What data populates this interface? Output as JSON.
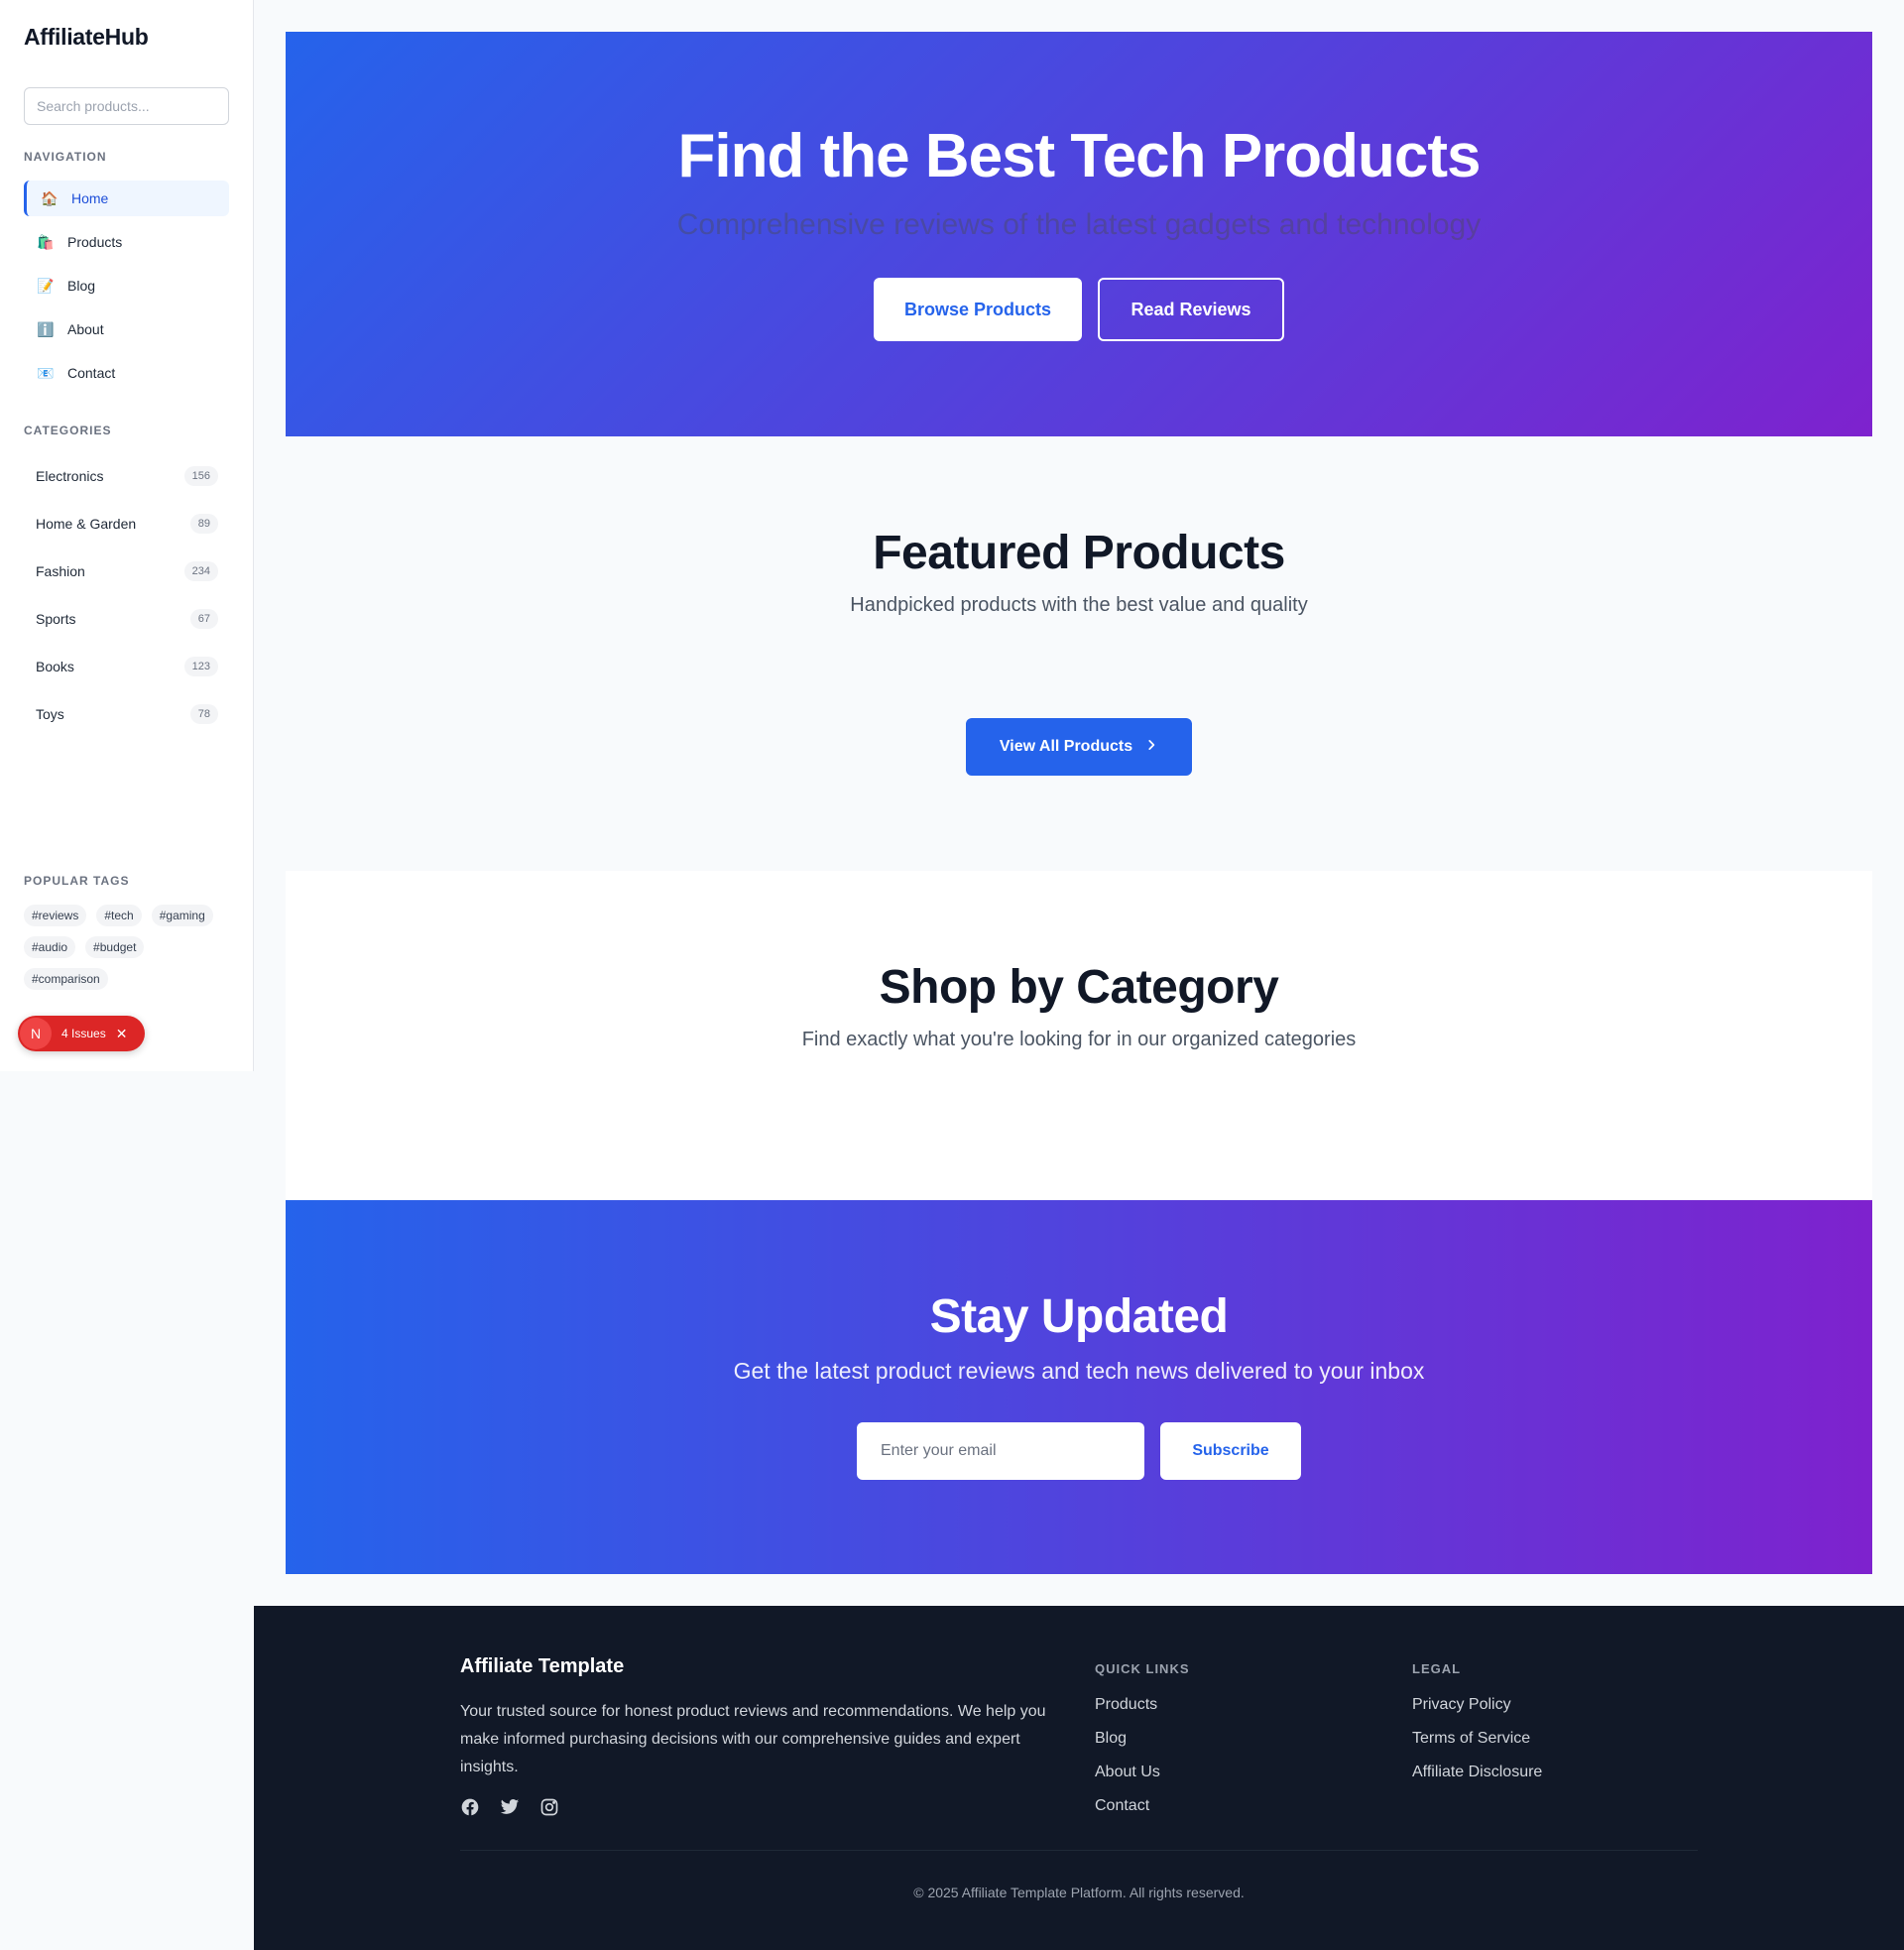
{
  "sidebar": {
    "logo": "AffiliateHub",
    "search_placeholder": "Search products...",
    "nav_title": "NAVIGATION",
    "nav_items": [
      {
        "label": "Home",
        "icon": "🏠"
      },
      {
        "label": "Products",
        "icon": "🛍️"
      },
      {
        "label": "Blog",
        "icon": "📝"
      },
      {
        "label": "About",
        "icon": "ℹ️"
      },
      {
        "label": "Contact",
        "icon": "📧"
      }
    ],
    "categories_title": "CATEGORIES",
    "categories": [
      {
        "label": "Electronics",
        "count": "156"
      },
      {
        "label": "Home & Garden",
        "count": "89"
      },
      {
        "label": "Fashion",
        "count": "234"
      },
      {
        "label": "Sports",
        "count": "67"
      },
      {
        "label": "Books",
        "count": "123"
      },
      {
        "label": "Toys",
        "count": "78"
      }
    ],
    "tags_title": "POPULAR TAGS",
    "tags": [
      "#reviews",
      "#tech",
      "#gaming",
      "#audio",
      "#budget",
      "#comparison"
    ],
    "issues": {
      "badge": "N",
      "label": "4 Issues",
      "close": "✕"
    }
  },
  "hero": {
    "title": "Find the Best Tech Products",
    "subtitle": "Comprehensive reviews of the latest gadgets and technology",
    "primary_button": "Browse Products",
    "secondary_button": "Read Reviews"
  },
  "featured": {
    "title": "Featured Products",
    "subtitle": "Handpicked products with the best value and quality",
    "view_all": "View All Products"
  },
  "shop": {
    "title": "Shop by Category",
    "subtitle": "Find exactly what you're looking for in our organized categories"
  },
  "newsletter": {
    "title": "Stay Updated",
    "subtitle": "Get the latest product reviews and tech news delivered to your inbox",
    "email_placeholder": "Enter your email",
    "subscribe": "Subscribe"
  },
  "footer": {
    "brand": "Affiliate Template",
    "description": "Your trusted source for honest product reviews and recommendations. We help you make informed purchasing decisions with our comprehensive guides and expert insights.",
    "quick_links_title": "QUICK LINKS",
    "quick_links": [
      "Products",
      "Blog",
      "About Us",
      "Contact"
    ],
    "legal_title": "LEGAL",
    "legal_links": [
      "Privacy Policy",
      "Terms of Service",
      "Affiliate Disclosure"
    ],
    "socials": [
      "facebook-icon",
      "twitter-icon",
      "instagram-icon"
    ],
    "copyright": "© 2025 Affiliate Template Platform. All rights reserved."
  },
  "colors": {
    "accent": "#2563eb",
    "gradient_end": "#7e22ce",
    "footer_bg": "#111827",
    "issues_red": "#dc2626"
  }
}
